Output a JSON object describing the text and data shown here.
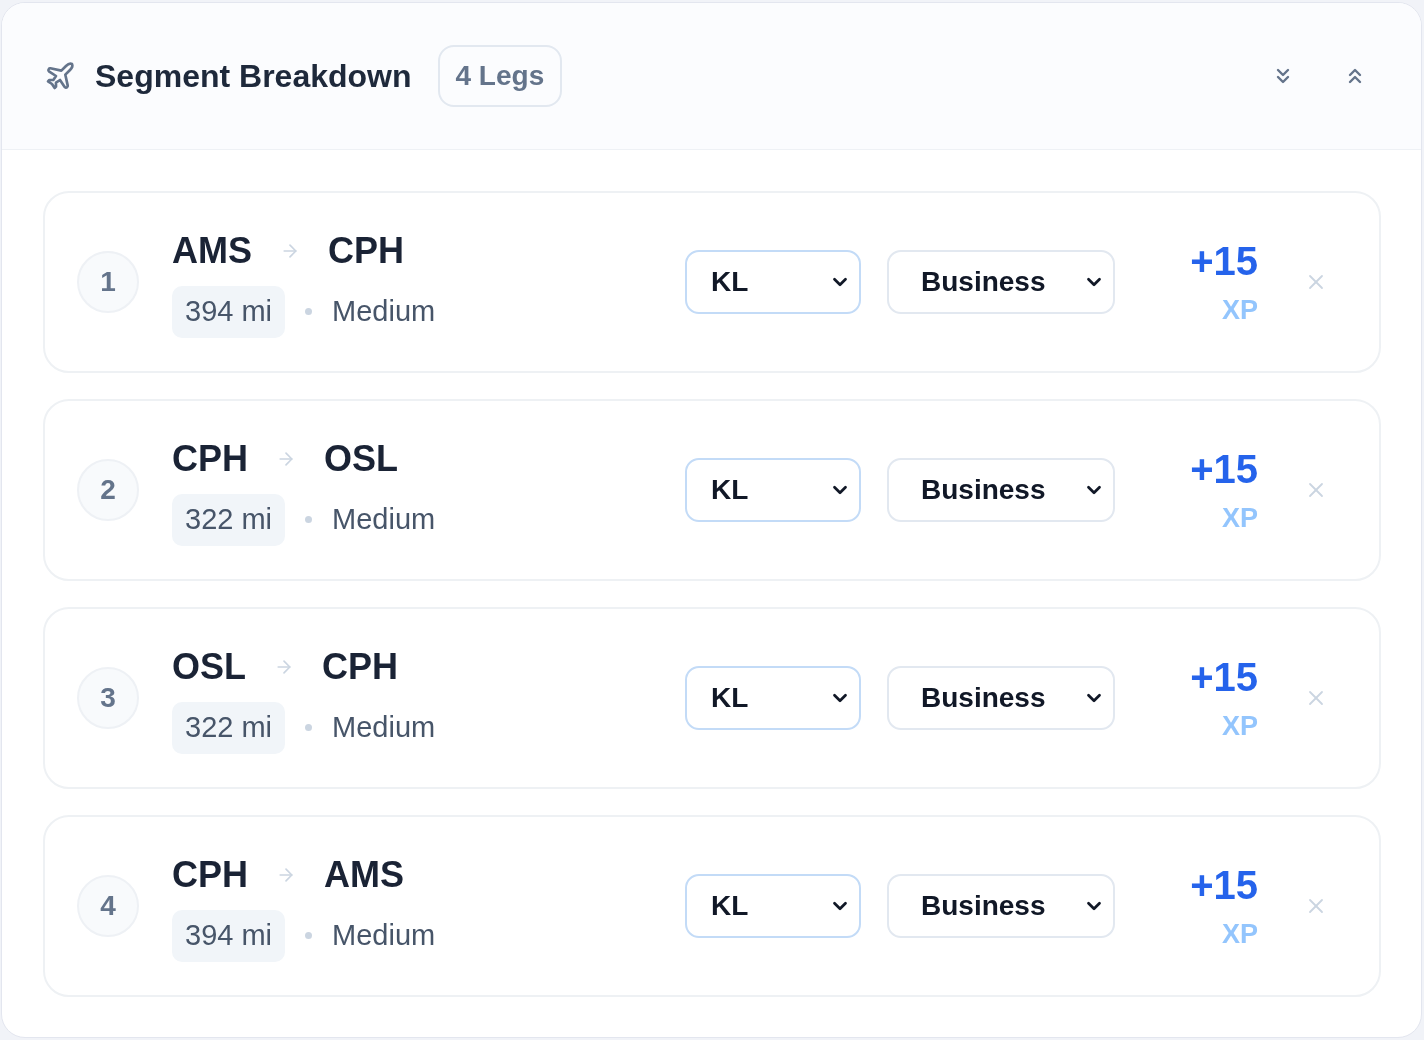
{
  "header": {
    "title": "Segment Breakdown",
    "badge": "4 Legs"
  },
  "legs": [
    {
      "number": "1",
      "origin": "AMS",
      "destination": "CPH",
      "distance": "394 mi",
      "haul": "Medium",
      "selects": [
        {
          "kind": "carrier",
          "value": "KL"
        },
        {
          "kind": "cabin",
          "value": "Business"
        }
      ],
      "xp": "+15",
      "xp_unit": "XP"
    },
    {
      "number": "2",
      "origin": "CPH",
      "destination": "OSL",
      "distance": "322 mi",
      "haul": "Medium",
      "selects": [
        {
          "kind": "carrier",
          "value": "KL"
        },
        {
          "kind": "cabin",
          "value": "Business"
        }
      ],
      "xp": "+15",
      "xp_unit": "XP"
    },
    {
      "number": "3",
      "origin": "OSL",
      "destination": "CPH",
      "distance": "322 mi",
      "haul": "Medium",
      "selects": [
        {
          "kind": "carrier",
          "value": "KL"
        },
        {
          "kind": "cabin",
          "value": "Business"
        }
      ],
      "xp": "+15",
      "xp_unit": "XP"
    },
    {
      "number": "4",
      "origin": "CPH",
      "destination": "AMS",
      "distance": "394 mi",
      "haul": "Medium",
      "selects": [
        {
          "kind": "carrier",
          "value": "KL"
        },
        {
          "kind": "cabin",
          "value": "Business"
        }
      ],
      "xp": "+15",
      "xp_unit": "XP"
    }
  ]
}
